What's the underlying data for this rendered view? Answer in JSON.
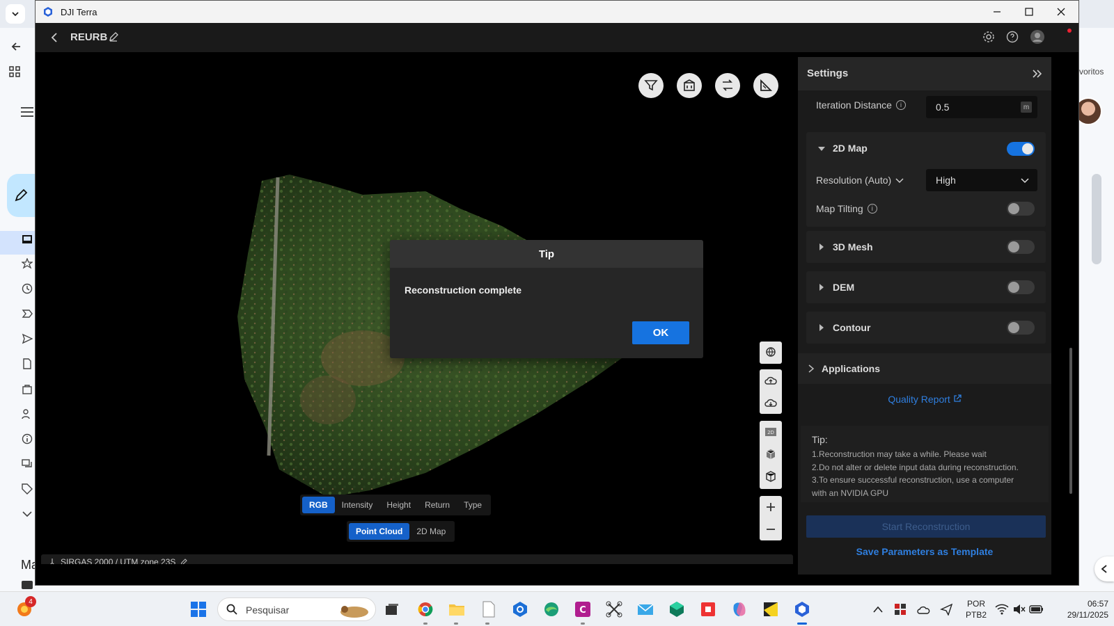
{
  "window": {
    "title": "DJI Terra"
  },
  "header": {
    "project_name": "REURB"
  },
  "browser": {
    "favorites_text": "voritos",
    "partial_label": "Ma"
  },
  "viewport": {
    "color_modes": [
      "RGB",
      "Intensity",
      "Height",
      "Return",
      "Type"
    ],
    "active_color_mode": "RGB",
    "view_modes": [
      "Point Cloud",
      "2D Map"
    ],
    "active_view_mode": "Point Cloud",
    "coordinate_system": "SIRGAS 2000 / UTM zone 23S"
  },
  "dialog": {
    "title": "Tip",
    "message": "Reconstruction complete",
    "ok_label": "OK"
  },
  "settings": {
    "title": "Settings",
    "iteration_distance": {
      "label": "Iteration Distance",
      "value": "0.5",
      "unit": "m"
    },
    "map2d": {
      "title": "2D Map",
      "enabled": true,
      "resolution_label": "Resolution (Auto)",
      "resolution_value": "High",
      "map_tilting_label": "Map Tilting",
      "map_tilting_enabled": false
    },
    "mesh3d": {
      "title": "3D Mesh",
      "enabled": false
    },
    "dem": {
      "title": "DEM",
      "enabled": false
    },
    "contour": {
      "title": "Contour",
      "enabled": false
    },
    "applications_label": "Applications",
    "quality_report_label": "Quality Report",
    "tip": {
      "title": "Tip:",
      "lines": [
        "1.Reconstruction may take a while. Please wait",
        "2.Do not alter or delete input data during reconstruction.",
        "3.To ensure successful reconstruction, use a computer",
        "with an NVIDIA GPU"
      ]
    },
    "start_button": "Start Reconstruction",
    "save_template": "Save Parameters as Template"
  },
  "taskbar": {
    "search_placeholder": "Pesquisar",
    "notification_badge": "4",
    "language": "POR",
    "keyboard": "PTB2",
    "time": "06:57",
    "date": "29/11/2025"
  },
  "colors": {
    "accent": "#1673e0",
    "link": "#2f7fe0"
  }
}
